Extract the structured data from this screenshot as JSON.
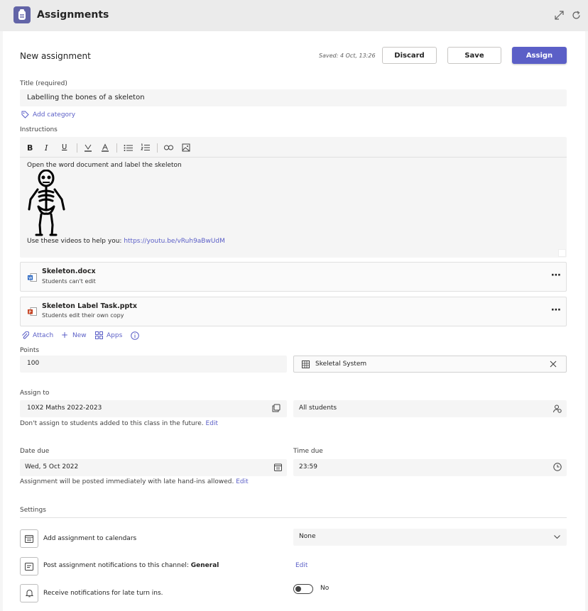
{
  "header": {
    "app_title": "Assignments"
  },
  "form": {
    "heading": "New assignment",
    "saved_status": "Saved: 4 Oct, 13:26",
    "discard_label": "Discard",
    "save_label": "Save",
    "assign_label": "Assign"
  },
  "title_field": {
    "label": "Title (required)",
    "value": "Labelling the bones of a skeleton"
  },
  "category": {
    "label": "Add category"
  },
  "instructions": {
    "label": "Instructions",
    "line1": "Open the word document and label the skeleton",
    "line2_prefix": "Use these videos to help you: ",
    "line2_link": "https://youtu.be/vRuh9aBwUdM",
    "toolbar": [
      "bold-icon",
      "italic-icon",
      "underline-icon",
      "highlight-icon",
      "font-color-icon",
      "bullet-list-icon",
      "numbered-list-icon",
      "link-icon",
      "image-icon"
    ]
  },
  "attachments": [
    {
      "name": "Skeleton.docx",
      "note": "Students can't edit",
      "icon": "word-file-icon",
      "color": "#185abd"
    },
    {
      "name": "Skeleton Label Task.pptx",
      "note": "Students edit their own copy",
      "icon": "powerpoint-file-icon",
      "color": "#c43e1c"
    }
  ],
  "attach_bar": {
    "attach": "Attach",
    "new": "New",
    "apps": "Apps"
  },
  "points": {
    "label": "Points",
    "value": "100"
  },
  "rubric": {
    "value": "Skeletal System"
  },
  "assign_to": {
    "label": "Assign to",
    "class_value": "10X2 Maths 2022-2023",
    "students_value": "All students",
    "note": "Don't assign to students added to this class in the future.",
    "edit_label": "Edit"
  },
  "due": {
    "date_label": "Date due",
    "date_value": "Wed, 5 Oct 2022",
    "time_label": "Time due",
    "time_value": "23:59",
    "note": "Assignment will be posted immediately with late hand-ins allowed.",
    "edit_label": "Edit"
  },
  "settings": {
    "label": "Settings",
    "calendar_label": "Add assignment to calendars",
    "calendar_value": "None",
    "channel_label_prefix": "Post assignment notifications to this channel: ",
    "channel_name": "General",
    "channel_edit": "Edit",
    "late_label": "Receive notifications for late turn ins.",
    "late_toggle_value": "No"
  },
  "colors": {
    "accent": "#5b5fc7",
    "app_icon": "#6264a7"
  }
}
